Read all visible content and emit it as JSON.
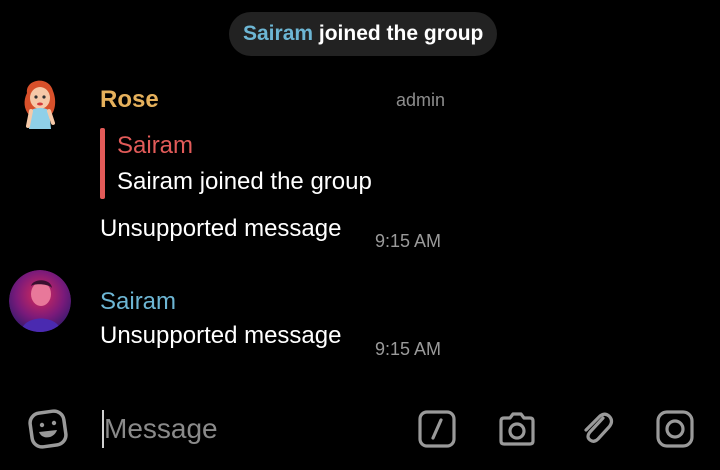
{
  "service_message": {
    "name": "Sairam",
    "action": "joined the group"
  },
  "messages": [
    {
      "sender": "Rose",
      "role_tag": "admin",
      "reply": {
        "name": "Sairam",
        "text": "Sairam joined the group"
      },
      "text": "Unsupported message",
      "time": "9:15 AM",
      "sender_color": "#e6b15c"
    },
    {
      "sender": "Sairam",
      "text": "Unsupported message",
      "time": "9:15 AM",
      "sender_color": "#6db6d4"
    }
  ],
  "composer": {
    "placeholder": "Message",
    "icons": [
      "emoji-icon",
      "bot-command-icon",
      "camera-icon",
      "attach-icon",
      "instagram-icon"
    ]
  },
  "colors": {
    "background": "#000000",
    "reply_accent": "#e25b59",
    "pill_background": "#222222"
  }
}
